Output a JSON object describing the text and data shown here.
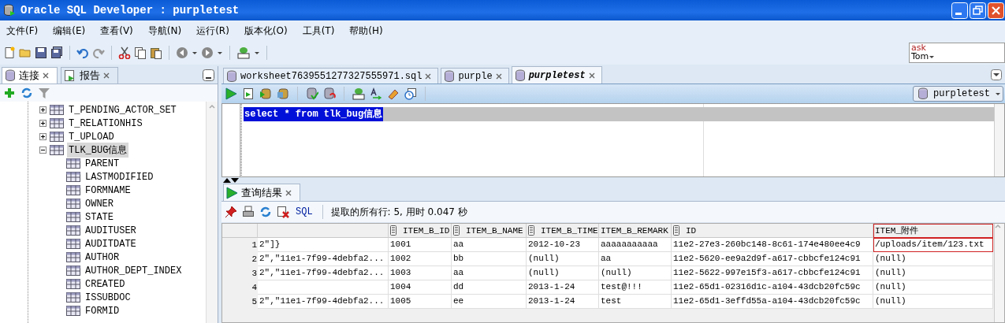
{
  "window": {
    "title": "Oracle SQL Developer : purpletest"
  },
  "menu": [
    "文件(F)",
    "编辑(E)",
    "查看(V)",
    "导航(N)",
    "运行(R)",
    "版本化(O)",
    "工具(T)",
    "帮助(H)"
  ],
  "ask_tom": {
    "line_1": "ask",
    "line_2": "Tom"
  },
  "left_panel": {
    "tabs": [
      {
        "label": "连接",
        "selected": true
      },
      {
        "label": "报告",
        "selected": false
      }
    ],
    "tree": [
      {
        "label": "T_PENDING_ACTOR_SET",
        "expanded": false,
        "selected": false
      },
      {
        "label": "T_RELATIONHIS",
        "expanded": false,
        "selected": false
      },
      {
        "label": "T_UPLOAD",
        "expanded": false,
        "selected": false
      },
      {
        "label": "TLK_BUG信息",
        "expanded": true,
        "selected": true,
        "children": [
          {
            "label": "PARENT"
          },
          {
            "label": "LASTMODIFIED"
          },
          {
            "label": "FORMNAME"
          },
          {
            "label": "OWNER"
          },
          {
            "label": "STATE"
          },
          {
            "label": "AUDITUSER"
          },
          {
            "label": "AUDITDATE"
          },
          {
            "label": "AUTHOR"
          },
          {
            "label": "AUTHOR_DEPT_INDEX"
          },
          {
            "label": "CREATED"
          },
          {
            "label": "ISSUBDOC"
          },
          {
            "label": "FORMID"
          }
        ]
      }
    ]
  },
  "editor": {
    "tabs": [
      {
        "label": "worksheet7639551277327555971.sql",
        "selected": false
      },
      {
        "label": "purple",
        "selected": false
      },
      {
        "label": "purpletest",
        "selected": true
      }
    ],
    "connection": "purpletest",
    "code": "select * from tlk_bug信息",
    "code_selected": true
  },
  "results": {
    "tab": "查询结果",
    "sql_button": "SQL",
    "status": "提取的所有行: 5, 用时 0.047 秒",
    "table": {
      "columns": [
        {
          "sort_icon": false,
          "highlighted": false
        },
        {
          "label": "ITEM_B_ID",
          "sort_icon": true,
          "highlighted": false
        },
        {
          "label": "ITEM_B_NAME",
          "sort_icon": true,
          "highlighted": false
        },
        {
          "label": "ITEM_B_TIME",
          "sort_icon": true,
          "highlighted": false
        },
        {
          "label": "ITEM_B_REMARK",
          "sort_icon": false,
          "highlighted": false
        },
        {
          "label": "ID",
          "sort_icon": true,
          "highlighted": false
        },
        {
          "label": "ITEM_附件",
          "sort_icon": false,
          "highlighted": true
        }
      ],
      "rows": [
        {
          "number": "1",
          "cells": [
            "2\"]}",
            "1001",
            "aa",
            "2012-10-23",
            "aaaaaaaaaaa",
            "11e2-27e3-260bc148-8c61-174e480ee4c9",
            "/uploads/item/123.txt"
          ]
        },
        {
          "number": "2",
          "cells": [
            "2\",\"11e1-7f99-4debfa2...",
            "1002",
            "bb",
            "(null)",
            "aa",
            "11e2-5620-ee9a2d9f-a617-cbbcfe124c91",
            "(null)"
          ]
        },
        {
          "number": "3",
          "cells": [
            "2\",\"11e1-7f99-4debfa2...",
            "1003",
            "aa",
            "(null)",
            "(null)",
            "11e2-5622-997e15f3-a617-cbbcfe124c91",
            "(null)"
          ]
        },
        {
          "number": "4",
          "cells": [
            null,
            "1004",
            "dd",
            "2013-1-24",
            "test@!!!",
            "11e2-65d1-02316d1c-a104-43dcb20fc59c",
            "(null)"
          ]
        },
        {
          "number": "5",
          "cells": [
            "2\",\"11e1-7f99-4debfa2...",
            "1005",
            "ee",
            "2013-1-24",
            "test",
            "11e2-65d1-3effd55a-a104-43dcb20fc59c",
            "(null)"
          ]
        }
      ]
    }
  }
}
